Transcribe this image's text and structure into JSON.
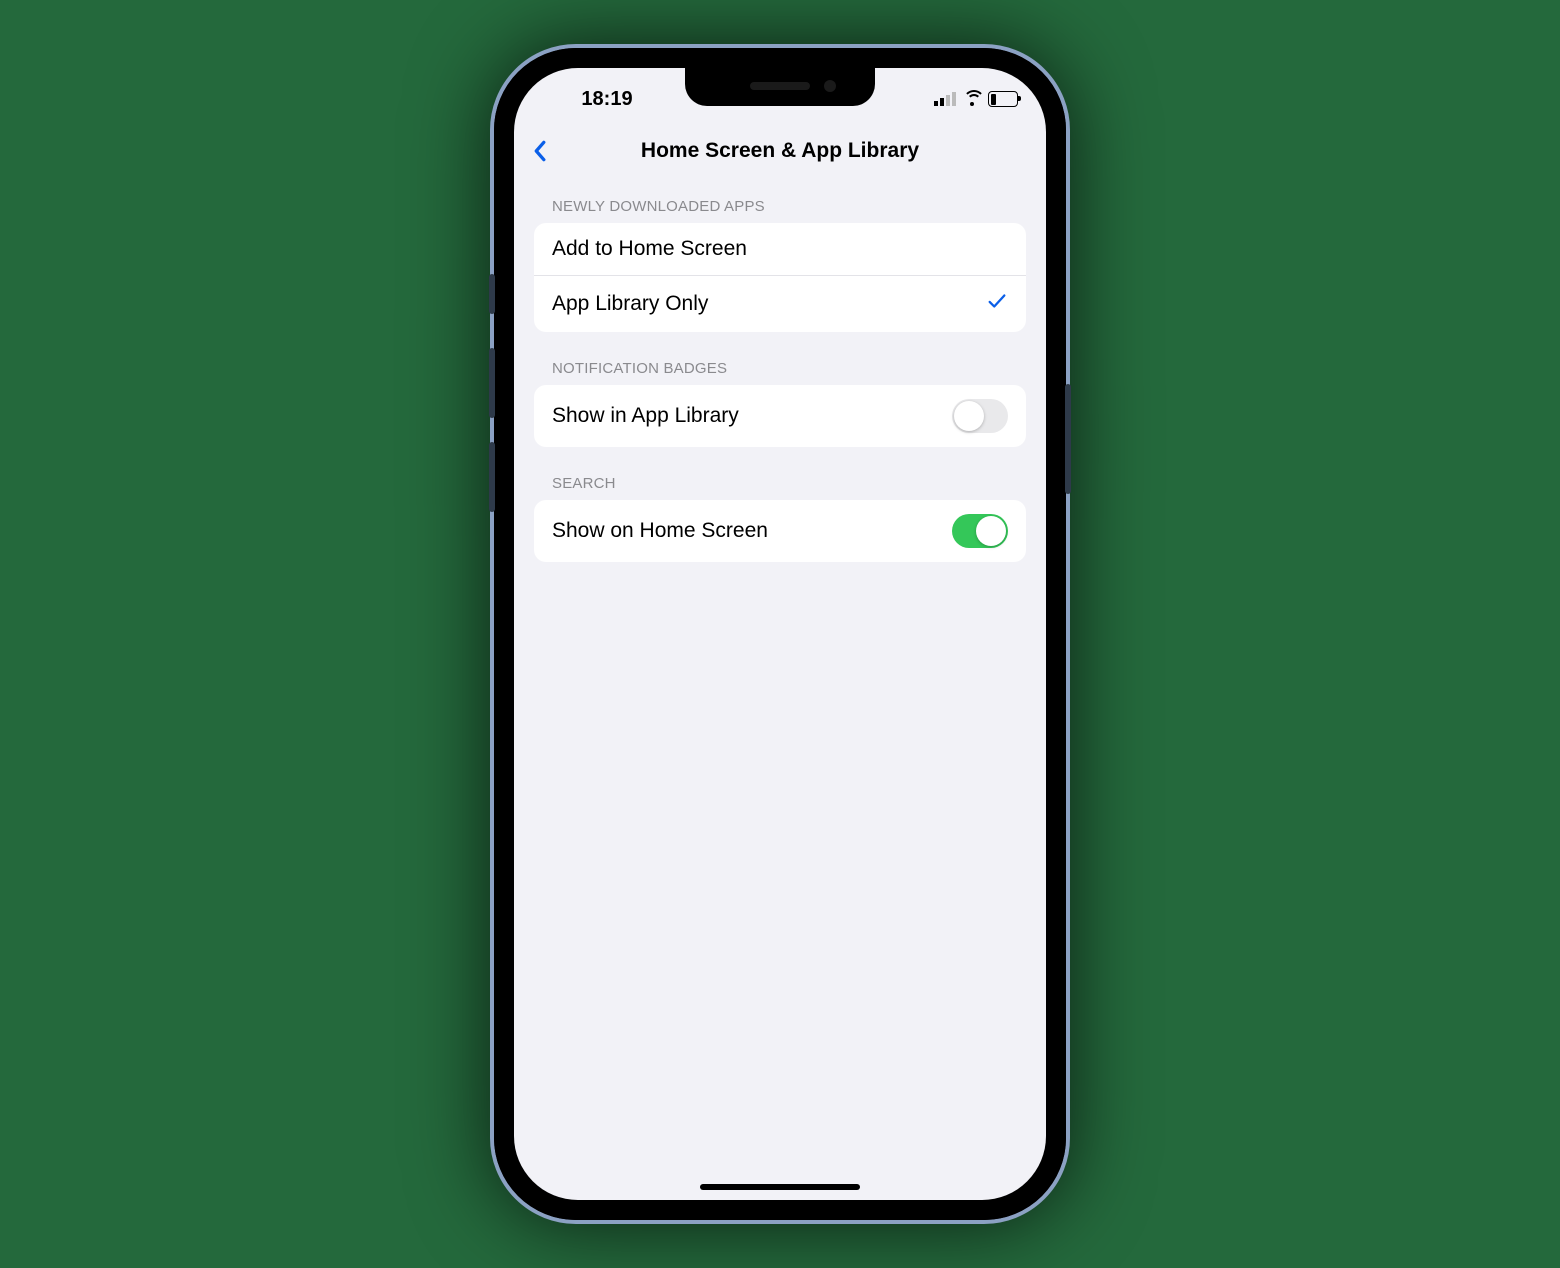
{
  "statusbar": {
    "time": "18:19"
  },
  "nav": {
    "title": "Home Screen & App Library"
  },
  "sections": {
    "newly_downloaded": {
      "header": "NEWLY DOWNLOADED APPS",
      "option_add": "Add to Home Screen",
      "option_library": "App Library Only",
      "selected": "library"
    },
    "notification_badges": {
      "header": "NOTIFICATION BADGES",
      "show_in_library_label": "Show in App Library",
      "show_in_library_on": false
    },
    "search": {
      "header": "SEARCH",
      "show_on_home_label": "Show on Home Screen",
      "show_on_home_on": true
    }
  }
}
